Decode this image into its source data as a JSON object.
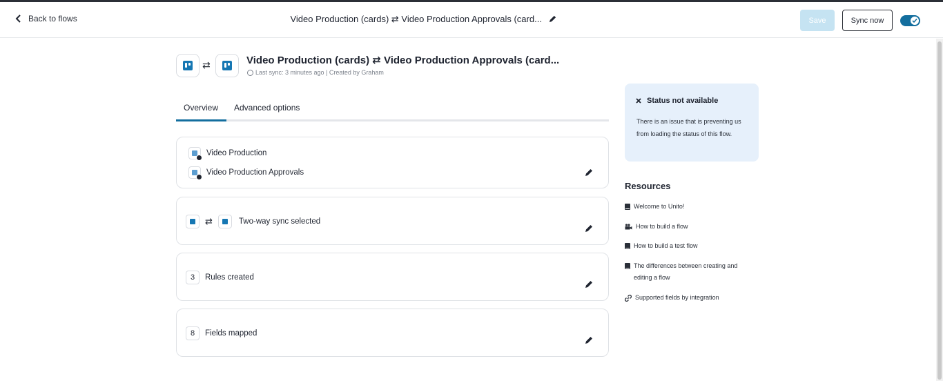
{
  "header": {
    "back_label": "Back to flows",
    "title": "Video Production (cards) ⇄ Video Production Approvals (card...",
    "save_label": "Save",
    "sync_label": "Sync now",
    "toggle_on": true
  },
  "flow": {
    "title": "Video Production (cards) ⇄ Video Production Approvals (card...",
    "meta": "Last sync: 3 minutes ago | Created by Graham",
    "tool_a_icon": "trello-icon",
    "tool_b_icon": "trello-icon"
  },
  "tabs": [
    {
      "label": "Overview",
      "active": true
    },
    {
      "label": "Advanced options",
      "active": false
    }
  ],
  "cards": {
    "boards": {
      "board_1": "Video Production",
      "board_2": "Video Production Approvals"
    },
    "sync": {
      "label": "Two-way sync selected"
    },
    "rules": {
      "count": "3",
      "label": "Rules created"
    },
    "fields": {
      "count": "8",
      "label": "Fields mapped"
    }
  },
  "status": {
    "title": "Status not available",
    "body": "There is an issue that is preventing us from loading the status of this flow."
  },
  "resources": {
    "title": "Resources",
    "items": [
      {
        "label": "Welcome to Unito!",
        "icon": "book-icon"
      },
      {
        "label": "How to build a flow",
        "icon": "video-icon"
      },
      {
        "label": "How to build a test flow",
        "icon": "book-icon"
      },
      {
        "label": "The differences between creating and editing a flow",
        "icon": "book-icon"
      },
      {
        "label": "Supported fields by integration",
        "icon": "link-icon"
      }
    ]
  },
  "colors": {
    "accent": "#136e9e",
    "save_disabled": "#c5e3f2",
    "status_bg": "#e6f0fb"
  }
}
